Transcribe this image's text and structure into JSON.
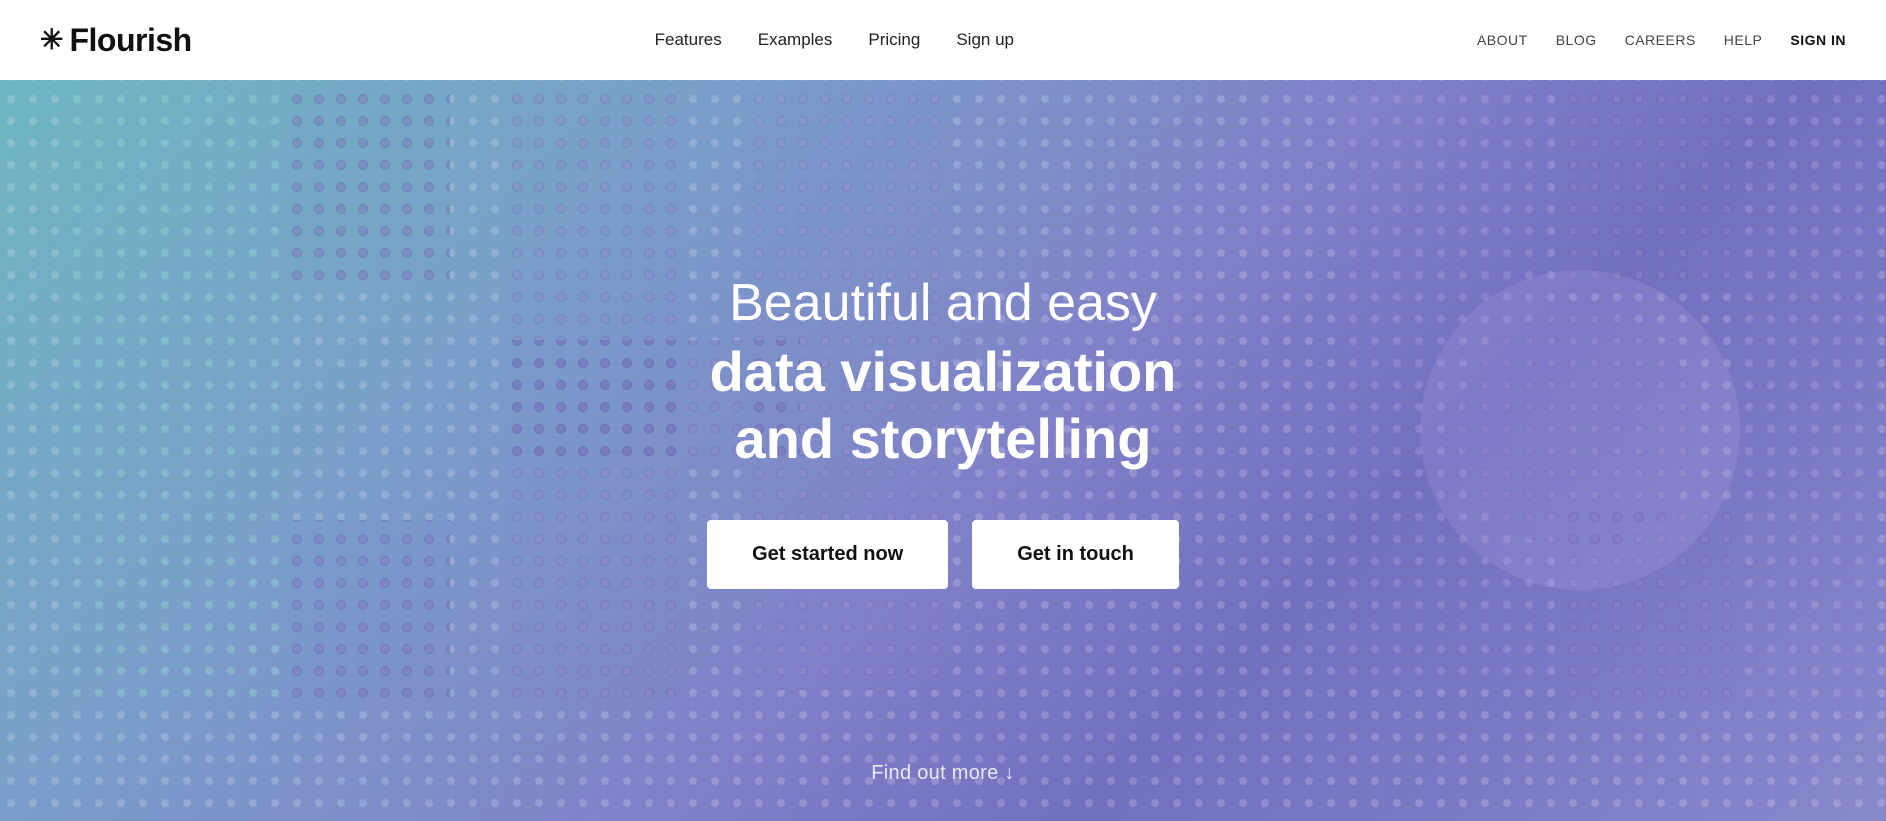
{
  "navbar": {
    "logo": {
      "asterisk": "✳",
      "text": "Flourish"
    },
    "center_links": [
      {
        "label": "Features",
        "href": "#"
      },
      {
        "label": "Examples",
        "href": "#"
      },
      {
        "label": "Pricing",
        "href": "#"
      },
      {
        "label": "Sign up",
        "href": "#"
      }
    ],
    "right_links": [
      {
        "label": "ABOUT",
        "href": "#"
      },
      {
        "label": "BLOG",
        "href": "#"
      },
      {
        "label": "CAREERS",
        "href": "#"
      },
      {
        "label": "HELP",
        "href": "#"
      },
      {
        "label": "SIGN IN",
        "href": "#",
        "class": "sign-in"
      }
    ]
  },
  "hero": {
    "subtitle": "Beautiful and easy",
    "title_line1": "data visualization",
    "title_line2": "and storytelling",
    "button_primary": "Get started now",
    "button_secondary": "Get in touch",
    "find_more": "Find out more ↓"
  }
}
